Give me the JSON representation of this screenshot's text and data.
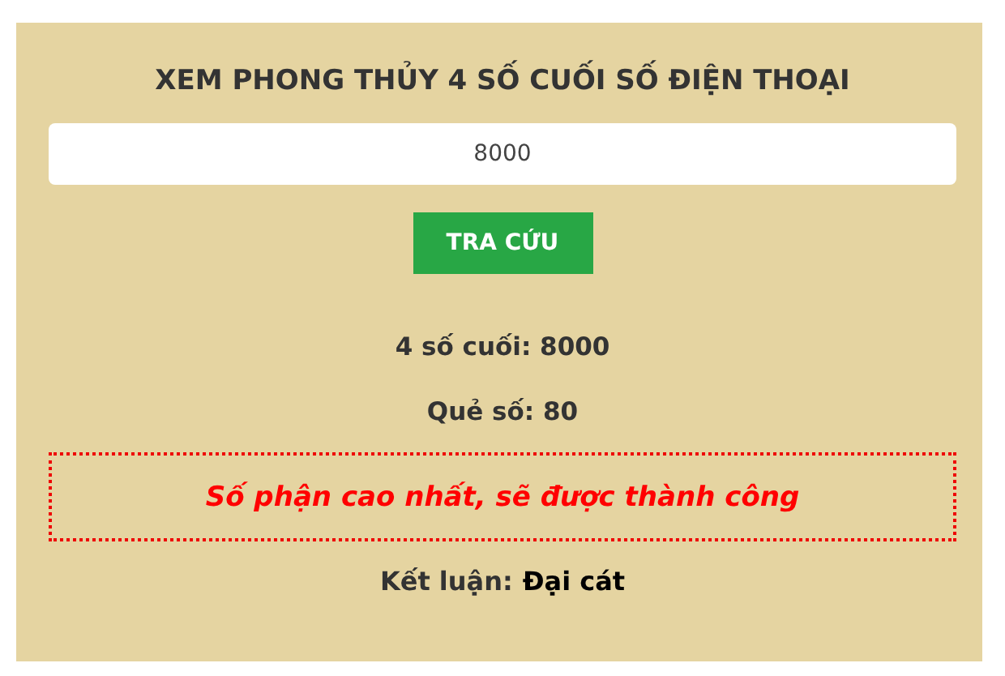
{
  "title": "XEM PHONG THỦY 4 SỐ CUỐI SỐ ĐIỆN THOẠI",
  "input": {
    "value": "8000"
  },
  "button": "TRA CỨU",
  "results": [
    "4 số cuối: 8000",
    "Quẻ số: 80"
  ],
  "message": "Số phận cao nhất, sẽ được thành công",
  "conclusion": {
    "label": "Kết luận:",
    "value": "Đại cát"
  }
}
